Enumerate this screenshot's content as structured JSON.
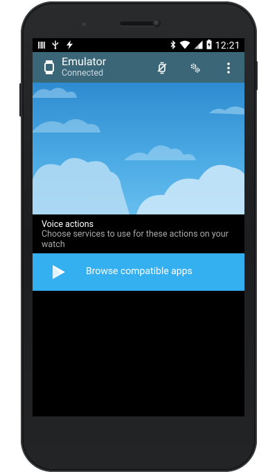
{
  "status_bar": {
    "time": "12:21",
    "left_icons": [
      "barcode-icon",
      "usb-icon",
      "flash-icon"
    ],
    "right_icons": [
      "bluetooth-icon",
      "wifi-icon",
      "signal-icon",
      "battery-charging-icon"
    ]
  },
  "toolbar": {
    "title": "Emulator",
    "subtitle": "Connected",
    "actions": [
      "watch-sync-icon",
      "settings-icon",
      "overflow-menu-icon"
    ],
    "color": "#3b6677"
  },
  "voice_actions": {
    "title": "Voice actions",
    "description": "Choose services to use for these actions on your watch"
  },
  "browse_button": {
    "label": "Browse compatible apps",
    "icon": "play-store-icon",
    "color": "#34b0f0"
  }
}
